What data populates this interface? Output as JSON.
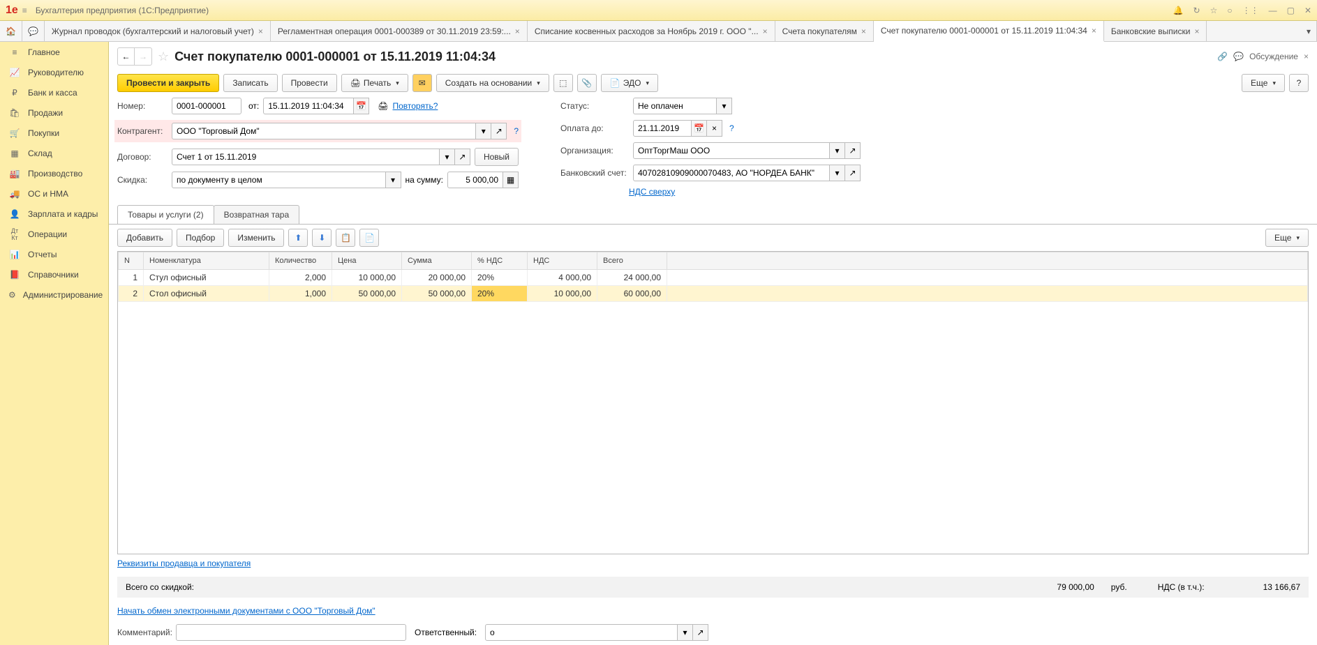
{
  "app": {
    "title": "Бухгалтерия предприятия  (1С:Предприятие)"
  },
  "tabs": [
    {
      "label": "Журнал проводок (бухгалтерский и налоговый учет)"
    },
    {
      "label": "Регламентная операция 0001-000389 от 30.11.2019 23:59:..."
    },
    {
      "label": "Списание косвенных расходов за Ноябрь 2019 г. ООО \"..."
    },
    {
      "label": "Счета покупателям"
    },
    {
      "label": "Счет покупателю 0001-000001 от 15.11.2019 11:04:34",
      "active": true
    },
    {
      "label": "Банковские выписки"
    }
  ],
  "sidebar": [
    {
      "icon": "≡",
      "label": "Главное"
    },
    {
      "icon": "↗",
      "label": "Руководителю"
    },
    {
      "icon": "₽",
      "label": "Банк и касса"
    },
    {
      "icon": "🛍",
      "label": "Продажи"
    },
    {
      "icon": "🛒",
      "label": "Покупки"
    },
    {
      "icon": "▦",
      "label": "Склад"
    },
    {
      "icon": "🏭",
      "label": "Производство"
    },
    {
      "icon": "🚚",
      "label": "ОС и НМА"
    },
    {
      "icon": "👤",
      "label": "Зарплата и кадры"
    },
    {
      "icon": "Дт",
      "label": "Операции"
    },
    {
      "icon": "📊",
      "label": "Отчеты"
    },
    {
      "icon": "📕",
      "label": "Справочники"
    },
    {
      "icon": "⚙",
      "label": "Администрирование"
    }
  ],
  "doc": {
    "title": "Счет покупателю 0001-000001 от 15.11.2019 11:04:34",
    "discuss": "Обсуждение"
  },
  "toolbar": {
    "post_close": "Провести и закрыть",
    "save": "Записать",
    "post": "Провести",
    "print": "Печать",
    "create_based": "Создать на основании",
    "edo": "ЭДО",
    "more": "Еще"
  },
  "fields": {
    "number_l": "Номер:",
    "number_v": "0001-000001",
    "from_l": "от:",
    "date_v": "15.11.2019 11:04:34",
    "repeat": "Повторять?",
    "status_l": "Статус:",
    "status_v": "Не оплачен",
    "contragent_l": "Контрагент:",
    "contragent_v": "ООО \"Торговый Дом\"",
    "pay_until_l": "Оплата до:",
    "pay_until_v": "21.11.2019",
    "contract_l": "Договор:",
    "contract_v": "Счет 1 от 15.11.2019",
    "new_btn": "Новый",
    "org_l": "Организация:",
    "org_v": "ОптТоргМаш ООО",
    "discount_l": "Скидка:",
    "discount_v": "по документу в целом",
    "on_sum_l": "на сумму:",
    "on_sum_v": "5 000,00",
    "bank_l": "Банковский счет:",
    "bank_v": "40702810909000070483, АО \"НОРДЕА БАНК\"",
    "nds_link": "НДС сверху"
  },
  "doc_tabs": {
    "goods": "Товары и услуги (2)",
    "tare": "Возвратная тара"
  },
  "tbl_toolbar": {
    "add": "Добавить",
    "pick": "Подбор",
    "edit": "Изменить",
    "more": "Еще"
  },
  "columns": {
    "n": "N",
    "nom": "Номенклатура",
    "qty": "Количество",
    "price": "Цена",
    "sum": "Сумма",
    "vat_pct": "% НДС",
    "vat": "НДС",
    "total": "Всего"
  },
  "rows": [
    {
      "n": "1",
      "nom": "Стул офисный",
      "qty": "2,000",
      "price": "10 000,00",
      "sum": "20 000,00",
      "vat_pct": "20%",
      "vat": "4 000,00",
      "total": "24 000,00"
    },
    {
      "n": "2",
      "nom": "Стол офисный",
      "qty": "1,000",
      "price": "50 000,00",
      "sum": "50 000,00",
      "vat_pct": "20%",
      "vat": "10 000,00",
      "total": "60 000,00"
    }
  ],
  "links": {
    "seller_buyer": "Реквизиты продавца и покупателя",
    "edo_start": "Начать обмен электронными документами с ООО \"Торговый Дом\""
  },
  "totals": {
    "total_l": "Всего со скидкой:",
    "total_v": "79 000,00",
    "rub": "руб.",
    "vat_l": "НДС (в т.ч.):",
    "vat_v": "13 166,67"
  },
  "footer": {
    "comment_l": "Комментарий:",
    "resp_l": "Ответственный:",
    "resp_v": "о"
  }
}
